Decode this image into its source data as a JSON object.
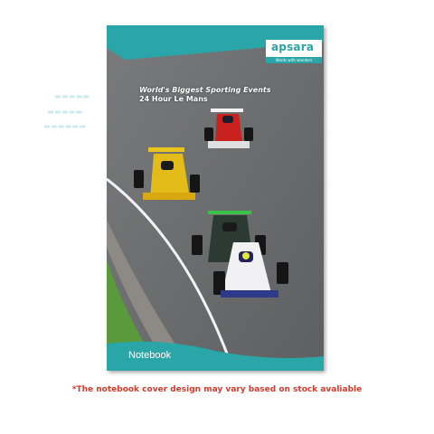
{
  "cover": {
    "brand": "apsara",
    "brand_tagline": "Words with wonders",
    "headline": "World's Biggest Sporting Events",
    "subheadline": "24 Hour Le Mans",
    "label": "Notebook"
  },
  "disclaimer": "*The notebook cover design may vary based on stock avaliable",
  "colors": {
    "teal": "#2aa6a8",
    "track": "#6e6f70",
    "grass": "#5a9a3c",
    "disclaimer": "#d8392b"
  }
}
